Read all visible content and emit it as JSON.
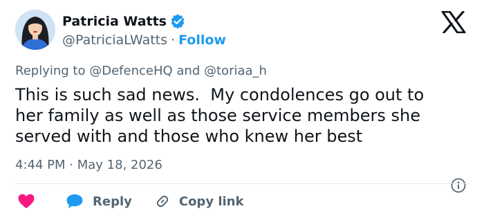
{
  "author": {
    "display_name": "Patricia Watts",
    "handle": "@PatriciaLWatts",
    "separator": "·",
    "follow_label": "Follow",
    "verified": true
  },
  "reply_context": {
    "prefix": "Replying to",
    "mentions": [
      "@DefenceHQ",
      "@toriaa_h"
    ],
    "conjunction": "and"
  },
  "tweet": {
    "lines": [
      "This is such sad news.  My condolences go out to",
      "her family as well as those service members she",
      "served with and those who knew her best"
    ],
    "time": "4:44 PM",
    "separator": "·",
    "date": "May 18, 2026"
  },
  "actions": {
    "reply_label": "Reply",
    "copy_link_label": "Copy link"
  },
  "icons": {
    "brand": "x-logo-icon",
    "verified": "verified-badge-icon",
    "like": "heart-icon",
    "reply": "speech-bubble-icon",
    "copy": "link-icon",
    "info": "info-icon"
  },
  "colors": {
    "text": "#0f1419",
    "secondary_text": "#536471",
    "accent_blue": "#1d9bf0",
    "like_pink": "#f91880",
    "divider": "#e1e8ed"
  }
}
